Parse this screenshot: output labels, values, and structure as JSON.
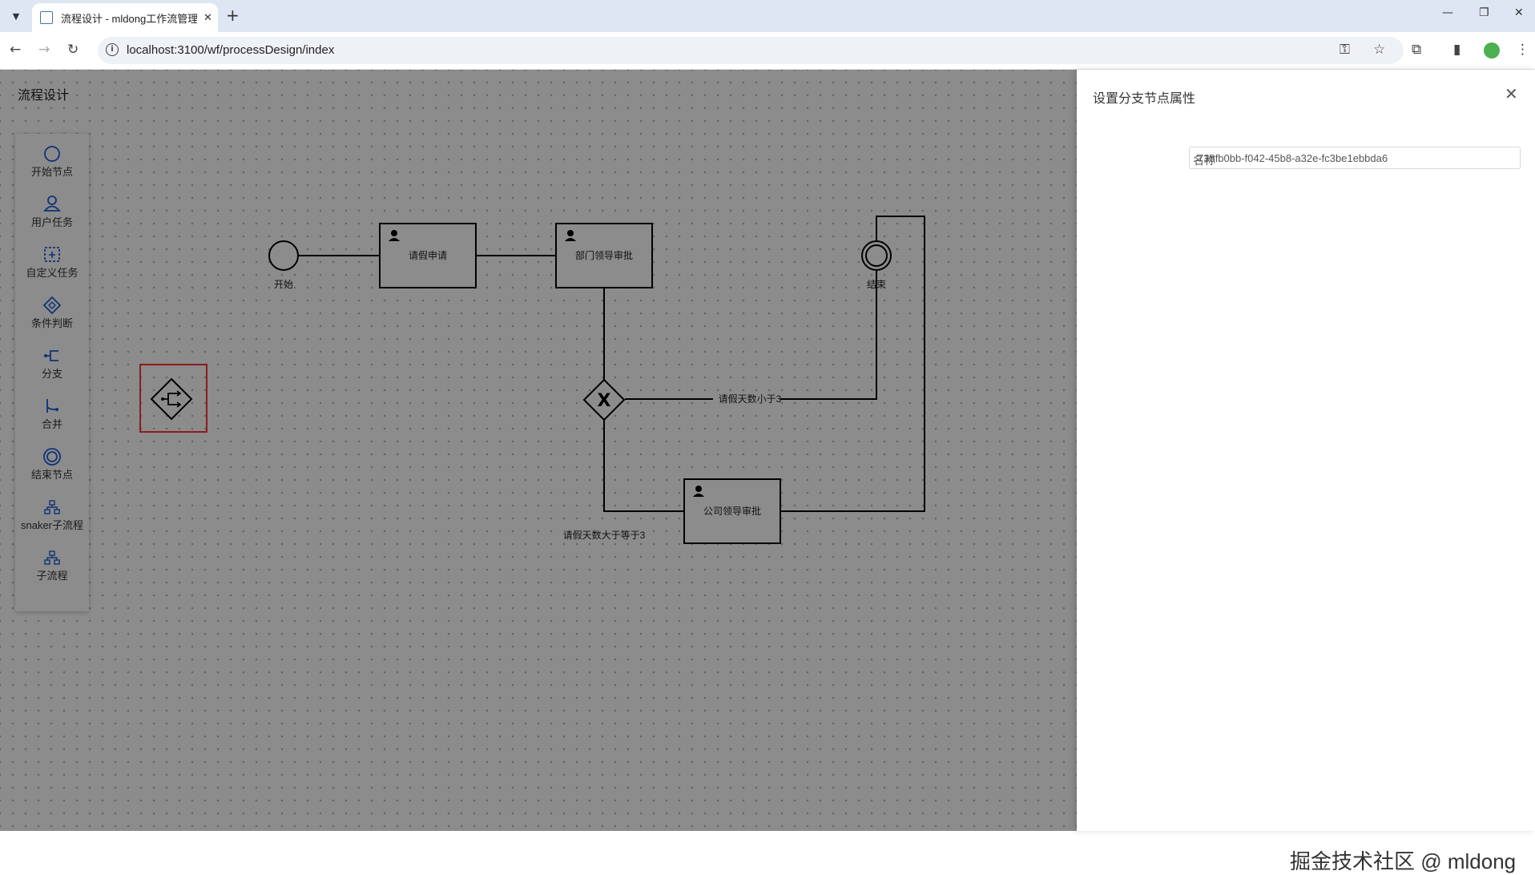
{
  "browser": {
    "tab_title": "流程设计 - mldong工作流管理",
    "url": "localhost:3100/wf/processDesign/index"
  },
  "page": {
    "title": "流程设计"
  },
  "palette": {
    "items": [
      {
        "label": "开始节点",
        "icon": "circle-icon"
      },
      {
        "label": "用户任务",
        "icon": "user-icon"
      },
      {
        "label": "自定义任务",
        "icon": "dashed-square-icon"
      },
      {
        "label": "条件判断",
        "icon": "diamond-icon"
      },
      {
        "label": "分支",
        "icon": "fork-icon"
      },
      {
        "label": "合并",
        "icon": "merge-icon"
      },
      {
        "label": "结束节点",
        "icon": "double-circle-icon"
      },
      {
        "label": "snaker子流程",
        "icon": "subprocess-icon"
      },
      {
        "label": "子流程",
        "icon": "subprocess-icon"
      }
    ]
  },
  "diagram": {
    "start_label": "开始",
    "task1_label": "请假申请",
    "task2_label": "部门领导审批",
    "task3_label": "公司领导审批",
    "end_label": "结束",
    "edge_lt3_label": "请假天数小于3",
    "edge_ge3_label": "请假天数大于等于3"
  },
  "drawer": {
    "title": "设置分支节点属性",
    "name_label": "名称",
    "name_value": "738fb0bb-f042-45b8-a32e-fc3be1ebbda6"
  },
  "watermark": "掘金技术社区 @ mldong",
  "colors": {
    "accent": "#1e5bd8",
    "highlight": "#ff3333",
    "overlay": "rgba(0,0,0,0.45)"
  }
}
